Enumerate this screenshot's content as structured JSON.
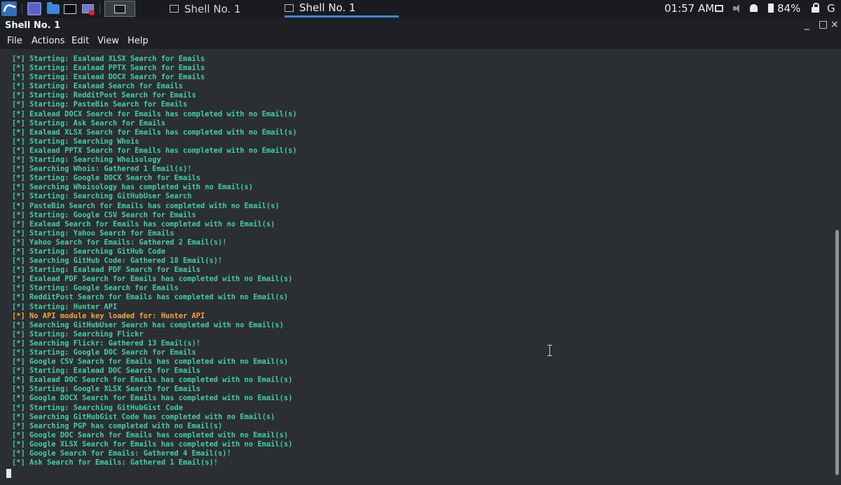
{
  "taskbar": {
    "tasks": [
      {
        "label": "Shell No. 1"
      },
      {
        "label": "Shell No. 1"
      }
    ],
    "clock": "01:57 AM",
    "battery": "84%",
    "power_glyph": "G"
  },
  "window": {
    "title": "Shell No. 1",
    "minimize": "_",
    "maximize": "□",
    "close": "×"
  },
  "menu": {
    "items": [
      "File",
      "Actions",
      "Edit",
      "View",
      "Help"
    ]
  },
  "terminal": {
    "lines": [
      "[*] Starting: Exalead XLSX Search for Emails",
      "[*] Starting: Exalead PPTX Search for Emails",
      "[*] Starting: Exalead DOCX Search for Emails",
      "[*] Starting: Exalead Search for Emails",
      "[*] Starting: RedditPost Search for Emails",
      "[*] Starting: PasteBin Search for Emails",
      "[*] Exalead DOCX Search for Emails has completed with no Email(s)",
      "[*] Starting: Ask Search for Emails",
      "[*] Exalead XLSX Search for Emails has completed with no Email(s)",
      "[*] Starting: Searching Whois",
      "[*] Exalead PPTX Search for Emails has completed with no Email(s)",
      "[*] Starting: Searching Whoisology",
      "[*] Searching Whois: Gathered 1 Email(s)!",
      "[*] Starting: Google DOCX Search for Emails",
      "[*] Searching Whoisology has completed with no Email(s)",
      "[*] Starting: Searching GitHubUser Search",
      "[*] PasteBin Search for Emails has completed with no Email(s)",
      "[*] Starting: Google CSV Search for Emails",
      "[*] Exalead Search for Emails has completed with no Email(s)",
      "[*] Starting: Yahoo Search for Emails",
      "[*] Yahoo Search for Emails: Gathered 2 Email(s)!",
      "[*] Starting: Searching GitHub Code",
      "[*] Searching GitHub Code: Gathered 18 Email(s)!",
      "[*] Starting: Exalead PDF Search for Emails",
      "[*] Exalead PDF Search for Emails has completed with no Email(s)",
      "[*] Starting: Google Search for Emails",
      "[*] RedditPost Search for Emails has completed with no Email(s)",
      "[*] Starting: Hunter API",
      "[*] No API module key loaded for: Hunter API",
      "[*] Searching GitHubUser Search has completed with no Email(s)",
      "[*] Starting: Searching Flickr",
      "[*] Searching Flickr: Gathered 13 Email(s)!",
      "[*] Starting: Google DOC Search for Emails",
      "[*] Google CSV Search for Emails has completed with no Email(s)",
      "[*] Starting: Exalead DOC Search for Emails",
      "[*] Exalead DOC Search for Emails has completed with no Email(s)",
      "[*] Starting: Google XLSX Search for Emails",
      "[*] Google DOCX Search for Emails has completed with no Email(s)",
      "[*] Starting: Searching GitHubGist Code",
      "[*] Searching GitHubGist Code has completed with no Email(s)",
      "[*] Searching PGP has completed with no Email(s)",
      "[*] Google DOC Search for Emails has completed with no Email(s)",
      "[*] Google XLSX Search for Emails has completed with no Email(s)",
      "[*] Google Search for Emails: Gathered 4 Email(s)!",
      "[*] Ask Search for Emails: Gathered 1 Email(s)!"
    ],
    "warning_line_index": 28,
    "colors": {
      "normal": "#41d0a0",
      "warning": "#f2a73c",
      "background": "#2b2f33"
    }
  }
}
